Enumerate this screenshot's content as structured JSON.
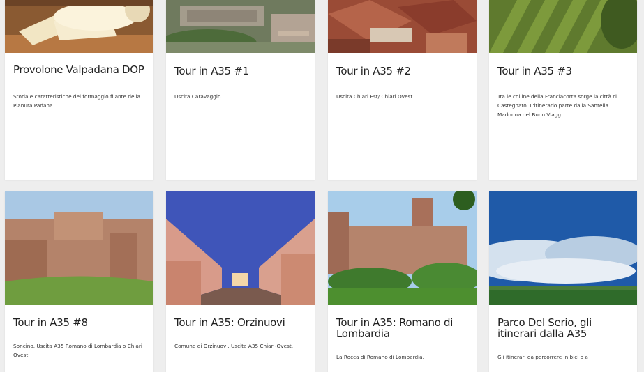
{
  "cards": [
    {
      "title": "Provolone Valpadana DOP",
      "description": "Storia e caratteristiche del formaggio filante della Pianura Padana",
      "image": "cheese-photo"
    },
    {
      "title": "Tour in A35 #1",
      "description": "Uscita Caravaggio",
      "image": "aerial-town-photo"
    },
    {
      "title": "Tour in A35 #2",
      "description": "Uscita Chiari Est/ Chiari Ovest",
      "image": "rooftops-photo"
    },
    {
      "title": "Tour in A35 #3",
      "description": "Tra le colline della Franciacorta sorge la città di Castegnato. L'itinerario parte dalla Santella Madonna del Buon Viagg...",
      "image": "vineyard-photo"
    },
    {
      "title": "Tour in A35 #8",
      "description": "Soncino. Uscita A35 Romano di Lombardia o Chiari Ovest",
      "image": "castle-walls-photo"
    },
    {
      "title": "Tour in A35: Orzinuovi",
      "description": "Comune di Orzinuovi. Uscita A35 Chiari-Ovest.",
      "image": "night-street-photo"
    },
    {
      "title": "Tour in A35: Romano di Lombardia",
      "description": "La Rocca di Romano di Lombardia.",
      "image": "fortress-photo"
    },
    {
      "title": "Parco Del Serio, gli itinerari dalla A35",
      "description": "Gli itinerari da percorrere in bici o a",
      "image": "sky-field-photo"
    }
  ]
}
